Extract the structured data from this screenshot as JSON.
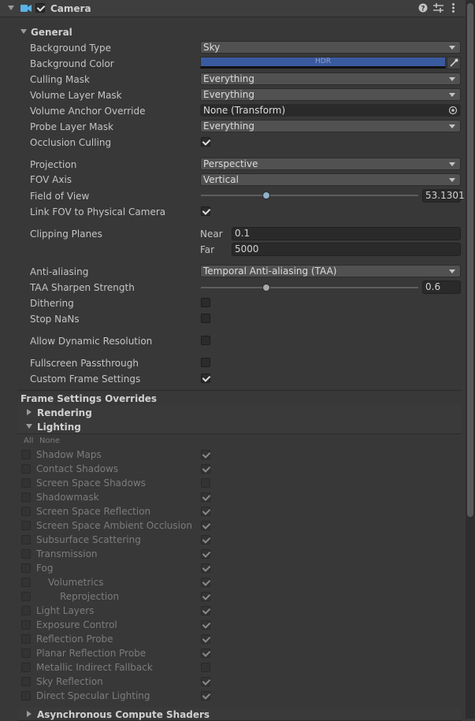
{
  "component": {
    "title": "Camera",
    "enabled": true
  },
  "general": {
    "title": "General",
    "background_type": {
      "label": "Background Type",
      "value": "Sky"
    },
    "background_color": {
      "label": "Background Color",
      "value": "HDR",
      "color": "#3a5aa0"
    },
    "culling_mask": {
      "label": "Culling Mask",
      "value": "Everything"
    },
    "volume_layer_mask": {
      "label": "Volume Layer Mask",
      "value": "Everything"
    },
    "volume_anchor_override": {
      "label": "Volume Anchor Override",
      "value": "None (Transform)"
    },
    "probe_layer_mask": {
      "label": "Probe Layer Mask",
      "value": "Everything"
    },
    "occlusion_culling": {
      "label": "Occlusion Culling",
      "checked": true
    },
    "projection": {
      "label": "Projection",
      "value": "Perspective"
    },
    "fov_axis": {
      "label": "FOV Axis",
      "value": "Vertical"
    },
    "field_of_view": {
      "label": "Field of View",
      "value": "53.1301",
      "fraction": 0.3
    },
    "link_fov": {
      "label": "Link FOV to Physical Camera",
      "checked": true
    },
    "clipping_planes": {
      "label": "Clipping Planes",
      "near_label": "Near",
      "near": "0.1",
      "far_label": "Far",
      "far": "5000"
    },
    "anti_aliasing": {
      "label": "Anti-aliasing",
      "value": "Temporal Anti-aliasing (TAA)"
    },
    "taa_sharpen": {
      "label": "TAA Sharpen Strength",
      "value": "0.6",
      "fraction": 0.3
    },
    "dithering": {
      "label": "Dithering",
      "checked": false
    },
    "stop_nans": {
      "label": "Stop NaNs",
      "checked": false
    },
    "allow_dynamic_resolution": {
      "label": "Allow Dynamic Resolution",
      "checked": false
    },
    "fullscreen_passthrough": {
      "label": "Fullscreen Passthrough",
      "checked": false
    },
    "custom_frame_settings": {
      "label": "Custom Frame Settings",
      "checked": true
    }
  },
  "frame_settings": {
    "title": "Frame Settings Overrides",
    "rendering": "Rendering",
    "lighting": "Lighting",
    "all": "All",
    "none": "None",
    "async": "Asynchronous Compute Shaders",
    "items": [
      {
        "label": "Shadow Maps",
        "checked": true
      },
      {
        "label": "Contact Shadows",
        "checked": true
      },
      {
        "label": "Screen Space Shadows",
        "checked": false
      },
      {
        "label": "Shadowmask",
        "checked": true
      },
      {
        "label": "Screen Space Reflection",
        "checked": true
      },
      {
        "label": "Screen Space Ambient Occlusion",
        "checked": true
      },
      {
        "label": "Subsurface Scattering",
        "checked": true
      },
      {
        "label": "Transmission",
        "checked": true
      },
      {
        "label": "Fog",
        "checked": true
      },
      {
        "label": "Volumetrics",
        "checked": true
      },
      {
        "label": "Reprojection",
        "checked": true
      },
      {
        "label": "Light Layers",
        "checked": true
      },
      {
        "label": "Exposure Control",
        "checked": true
      },
      {
        "label": "Reflection Probe",
        "checked": true
      },
      {
        "label": "Planar Reflection Probe",
        "checked": true
      },
      {
        "label": "Metallic Indirect Fallback",
        "checked": false
      },
      {
        "label": "Sky Reflection",
        "checked": true
      },
      {
        "label": "Direct Specular Lighting",
        "checked": true
      }
    ]
  }
}
